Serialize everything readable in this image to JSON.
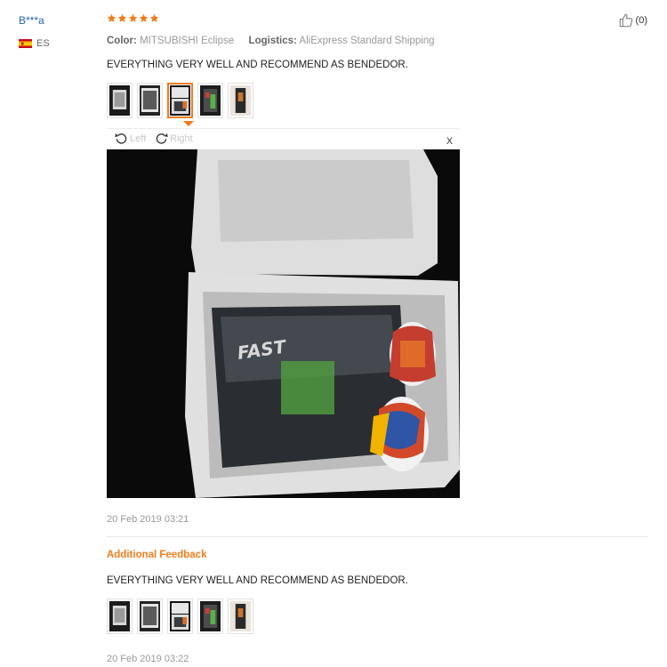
{
  "reviewer": {
    "name": "B***a",
    "country_code": "ES"
  },
  "rating": {
    "stars": 5,
    "max": 5,
    "color": "#f07c1b"
  },
  "helpful": {
    "count_text": "(0)"
  },
  "meta": {
    "color_label": "Color:",
    "color_value": "MITSUBISHI Eclipse",
    "logistics_label": "Logistics:",
    "logistics_value": "AliExpress Standard Shipping"
  },
  "review": {
    "text": "EVERYTHING VERY WELL AND RECOMMEND AS BENDEDOR.",
    "date": "20 Feb 2019 03:21",
    "thumbnails": [
      "photo-1",
      "photo-2",
      "photo-3",
      "photo-4",
      "photo-5"
    ],
    "active_thumbnail": 3
  },
  "viewer": {
    "rotate_left_label": "Left",
    "rotate_right_label": "Right",
    "close_label": "x"
  },
  "additional_feedback": {
    "title": "Additional Feedback",
    "text": "EVERYTHING VERY WELL AND RECOMMEND AS BENDEDOR.",
    "date": "20 Feb 2019 03:22",
    "thumbnails": [
      "photo-1",
      "photo-2",
      "photo-3",
      "photo-4",
      "photo-5"
    ]
  },
  "icons": {
    "flag": "spain-flag-icon",
    "star": "star-icon",
    "like": "thumbs-up-icon",
    "rotate_left": "rotate-left-icon",
    "rotate_right": "rotate-right-icon",
    "close": "close-icon"
  }
}
